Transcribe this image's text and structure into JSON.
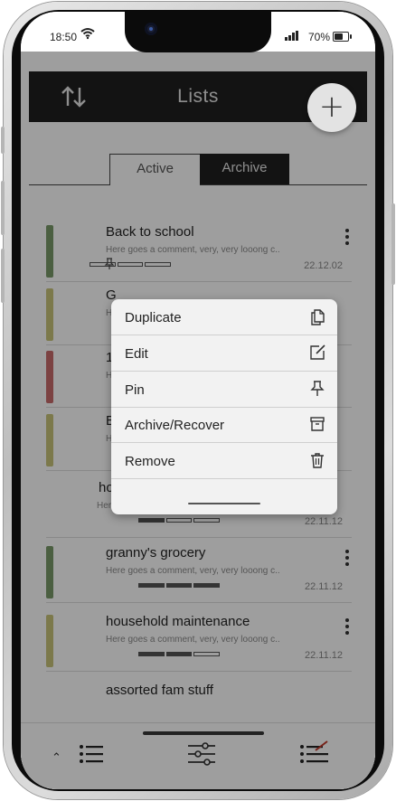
{
  "status_bar": {
    "time": "18:50",
    "battery": "70%",
    "battery_level": 0.7
  },
  "header": {
    "title": "Lists",
    "add_label": "+"
  },
  "tabs": [
    {
      "label": "Active"
    },
    {
      "label": "Archive"
    }
  ],
  "lists": [
    {
      "title": "Back to school",
      "comment": "Here goes a comment, very, very looong c..",
      "date": "22.12.02",
      "color": "#7a9a6a",
      "pinned": true,
      "progress": [
        0,
        0,
        0
      ]
    },
    {
      "title": "G",
      "comment": "H",
      "date": "",
      "color": "#c8c47a",
      "pinned": false,
      "progress": []
    },
    {
      "title": "1",
      "comment": "H",
      "date": "",
      "color": "#c96b6b",
      "pinned": false,
      "progress": []
    },
    {
      "title": "Ba",
      "comment": "He",
      "date": "",
      "color": "#c8c47a",
      "pinned": false,
      "progress": []
    },
    {
      "title": "ho",
      "comment": "Here goes a comment, very, very looong c..",
      "date": "22.11.12",
      "color": "",
      "pinned": false,
      "progress": [
        1,
        0,
        0
      ]
    },
    {
      "title": "granny's grocery",
      "comment": "Here goes a comment, very, very looong c..",
      "date": "22.11.12",
      "color": "#7a9a6a",
      "pinned": false,
      "progress": [
        1,
        1,
        1
      ]
    },
    {
      "title": "household maintenance",
      "comment": "Here goes a comment, very, very looong c..",
      "date": "22.11.12",
      "color": "#c8c47a",
      "pinned": false,
      "progress": [
        1,
        1,
        0
      ]
    },
    {
      "title": "assorted fam stuff",
      "comment": "",
      "date": "",
      "color": "",
      "pinned": false,
      "progress": []
    }
  ],
  "context_menu": {
    "items": [
      {
        "label": "Duplicate",
        "icon": "duplicate-icon"
      },
      {
        "label": "Edit",
        "icon": "edit-icon"
      },
      {
        "label": "Pin",
        "icon": "pin-icon"
      },
      {
        "label": "Archive/Recover",
        "icon": "archive-icon"
      },
      {
        "label": "Remove",
        "icon": "trash-icon"
      }
    ]
  },
  "bottom_nav": {
    "icons": [
      "updown-icon",
      "list-icon",
      "filter-icon",
      "checklist-icon"
    ]
  }
}
